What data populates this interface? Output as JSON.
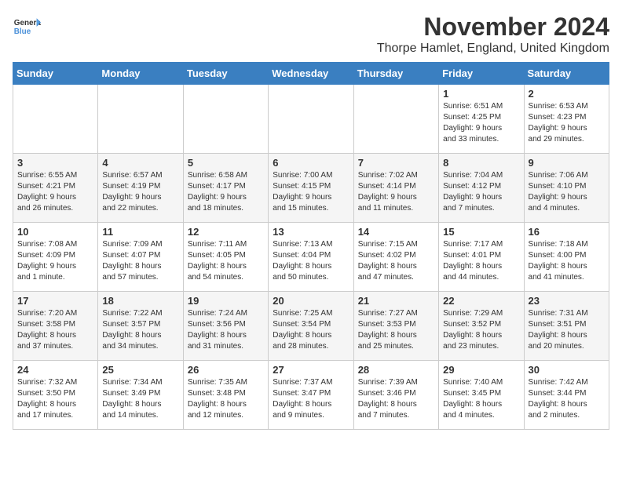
{
  "header": {
    "logo_general": "General",
    "logo_blue": "Blue",
    "month": "November 2024",
    "location": "Thorpe Hamlet, England, United Kingdom"
  },
  "weekdays": [
    "Sunday",
    "Monday",
    "Tuesday",
    "Wednesday",
    "Thursday",
    "Friday",
    "Saturday"
  ],
  "weeks": [
    [
      {
        "day": "",
        "info": ""
      },
      {
        "day": "",
        "info": ""
      },
      {
        "day": "",
        "info": ""
      },
      {
        "day": "",
        "info": ""
      },
      {
        "day": "",
        "info": ""
      },
      {
        "day": "1",
        "info": "Sunrise: 6:51 AM\nSunset: 4:25 PM\nDaylight: 9 hours\nand 33 minutes."
      },
      {
        "day": "2",
        "info": "Sunrise: 6:53 AM\nSunset: 4:23 PM\nDaylight: 9 hours\nand 29 minutes."
      }
    ],
    [
      {
        "day": "3",
        "info": "Sunrise: 6:55 AM\nSunset: 4:21 PM\nDaylight: 9 hours\nand 26 minutes."
      },
      {
        "day": "4",
        "info": "Sunrise: 6:57 AM\nSunset: 4:19 PM\nDaylight: 9 hours\nand 22 minutes."
      },
      {
        "day": "5",
        "info": "Sunrise: 6:58 AM\nSunset: 4:17 PM\nDaylight: 9 hours\nand 18 minutes."
      },
      {
        "day": "6",
        "info": "Sunrise: 7:00 AM\nSunset: 4:15 PM\nDaylight: 9 hours\nand 15 minutes."
      },
      {
        "day": "7",
        "info": "Sunrise: 7:02 AM\nSunset: 4:14 PM\nDaylight: 9 hours\nand 11 minutes."
      },
      {
        "day": "8",
        "info": "Sunrise: 7:04 AM\nSunset: 4:12 PM\nDaylight: 9 hours\nand 7 minutes."
      },
      {
        "day": "9",
        "info": "Sunrise: 7:06 AM\nSunset: 4:10 PM\nDaylight: 9 hours\nand 4 minutes."
      }
    ],
    [
      {
        "day": "10",
        "info": "Sunrise: 7:08 AM\nSunset: 4:09 PM\nDaylight: 9 hours\nand 1 minute."
      },
      {
        "day": "11",
        "info": "Sunrise: 7:09 AM\nSunset: 4:07 PM\nDaylight: 8 hours\nand 57 minutes."
      },
      {
        "day": "12",
        "info": "Sunrise: 7:11 AM\nSunset: 4:05 PM\nDaylight: 8 hours\nand 54 minutes."
      },
      {
        "day": "13",
        "info": "Sunrise: 7:13 AM\nSunset: 4:04 PM\nDaylight: 8 hours\nand 50 minutes."
      },
      {
        "day": "14",
        "info": "Sunrise: 7:15 AM\nSunset: 4:02 PM\nDaylight: 8 hours\nand 47 minutes."
      },
      {
        "day": "15",
        "info": "Sunrise: 7:17 AM\nSunset: 4:01 PM\nDaylight: 8 hours\nand 44 minutes."
      },
      {
        "day": "16",
        "info": "Sunrise: 7:18 AM\nSunset: 4:00 PM\nDaylight: 8 hours\nand 41 minutes."
      }
    ],
    [
      {
        "day": "17",
        "info": "Sunrise: 7:20 AM\nSunset: 3:58 PM\nDaylight: 8 hours\nand 37 minutes."
      },
      {
        "day": "18",
        "info": "Sunrise: 7:22 AM\nSunset: 3:57 PM\nDaylight: 8 hours\nand 34 minutes."
      },
      {
        "day": "19",
        "info": "Sunrise: 7:24 AM\nSunset: 3:56 PM\nDaylight: 8 hours\nand 31 minutes."
      },
      {
        "day": "20",
        "info": "Sunrise: 7:25 AM\nSunset: 3:54 PM\nDaylight: 8 hours\nand 28 minutes."
      },
      {
        "day": "21",
        "info": "Sunrise: 7:27 AM\nSunset: 3:53 PM\nDaylight: 8 hours\nand 25 minutes."
      },
      {
        "day": "22",
        "info": "Sunrise: 7:29 AM\nSunset: 3:52 PM\nDaylight: 8 hours\nand 23 minutes."
      },
      {
        "day": "23",
        "info": "Sunrise: 7:31 AM\nSunset: 3:51 PM\nDaylight: 8 hours\nand 20 minutes."
      }
    ],
    [
      {
        "day": "24",
        "info": "Sunrise: 7:32 AM\nSunset: 3:50 PM\nDaylight: 8 hours\nand 17 minutes."
      },
      {
        "day": "25",
        "info": "Sunrise: 7:34 AM\nSunset: 3:49 PM\nDaylight: 8 hours\nand 14 minutes."
      },
      {
        "day": "26",
        "info": "Sunrise: 7:35 AM\nSunset: 3:48 PM\nDaylight: 8 hours\nand 12 minutes."
      },
      {
        "day": "27",
        "info": "Sunrise: 7:37 AM\nSunset: 3:47 PM\nDaylight: 8 hours\nand 9 minutes."
      },
      {
        "day": "28",
        "info": "Sunrise: 7:39 AM\nSunset: 3:46 PM\nDaylight: 8 hours\nand 7 minutes."
      },
      {
        "day": "29",
        "info": "Sunrise: 7:40 AM\nSunset: 3:45 PM\nDaylight: 8 hours\nand 4 minutes."
      },
      {
        "day": "30",
        "info": "Sunrise: 7:42 AM\nSunset: 3:44 PM\nDaylight: 8 hours\nand 2 minutes."
      }
    ]
  ]
}
